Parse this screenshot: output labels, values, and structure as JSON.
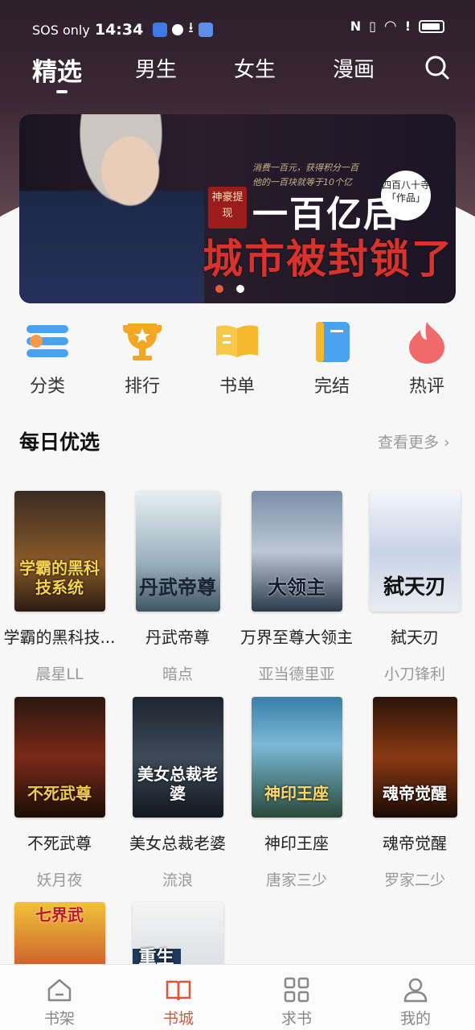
{
  "status_bar": {
    "left_text": "SOS only",
    "time": "14:34"
  },
  "top_tabs": [
    {
      "label": "精选",
      "active": true
    },
    {
      "label": "男生",
      "active": false
    },
    {
      "label": "女生",
      "active": false
    },
    {
      "label": "漫画",
      "active": false
    }
  ],
  "banner": {
    "subtitle_line1": "消费一百元，获得积分一百",
    "subtitle_line2": "他的一百块就等于10个亿",
    "tag": "神豪提现",
    "title_line1": "一百亿后",
    "title_line2": "城市被封锁了",
    "stamp": "四百八十寺「作品」",
    "slide_count": 2,
    "active_slide": 1
  },
  "quick_entries": [
    {
      "label": "分类",
      "icon": "category-icon"
    },
    {
      "label": "排行",
      "icon": "trophy-icon"
    },
    {
      "label": "书单",
      "icon": "book-list-icon"
    },
    {
      "label": "完结",
      "icon": "finished-book-icon"
    },
    {
      "label": "热评",
      "icon": "flame-icon"
    }
  ],
  "daily": {
    "title": "每日优选",
    "more": "查看更多 ›",
    "books": [
      {
        "name": "学霸的黑科技系统",
        "display_name": "学霸的黑科技...",
        "author": "晨星LL",
        "cover_text": "学霸的黑科技系统"
      },
      {
        "name": "丹武帝尊",
        "author": "暗点",
        "cover_text": "丹武帝尊"
      },
      {
        "name": "万界至尊大领主",
        "author": "亚当德里亚",
        "cover_text": "大领主"
      },
      {
        "name": "弑天刃",
        "author": "小刀锋利",
        "cover_text": "弑天刃"
      },
      {
        "name": "不死武尊",
        "author": "妖月夜",
        "cover_text": "不死武尊"
      },
      {
        "name": "美女总裁老婆",
        "author": "流浪",
        "cover_text": "美女总裁老婆"
      },
      {
        "name": "神印王座",
        "author": "唐家三少",
        "cover_text": "神印王座"
      },
      {
        "name": "魂帝觉醒",
        "author": "罗家二少",
        "cover_text": "魂帝觉醒"
      },
      {
        "name": "",
        "author": "",
        "cover_text": "七界武"
      },
      {
        "name": "",
        "author": "",
        "cover_text": "重生"
      }
    ]
  },
  "bottom_nav": [
    {
      "label": "书架",
      "active": false
    },
    {
      "label": "书城",
      "active": true
    },
    {
      "label": "求书",
      "active": false
    },
    {
      "label": "我的",
      "active": false
    }
  ],
  "colors": {
    "accent": "#e0553a",
    "header_bg": "#2c1f2a"
  }
}
